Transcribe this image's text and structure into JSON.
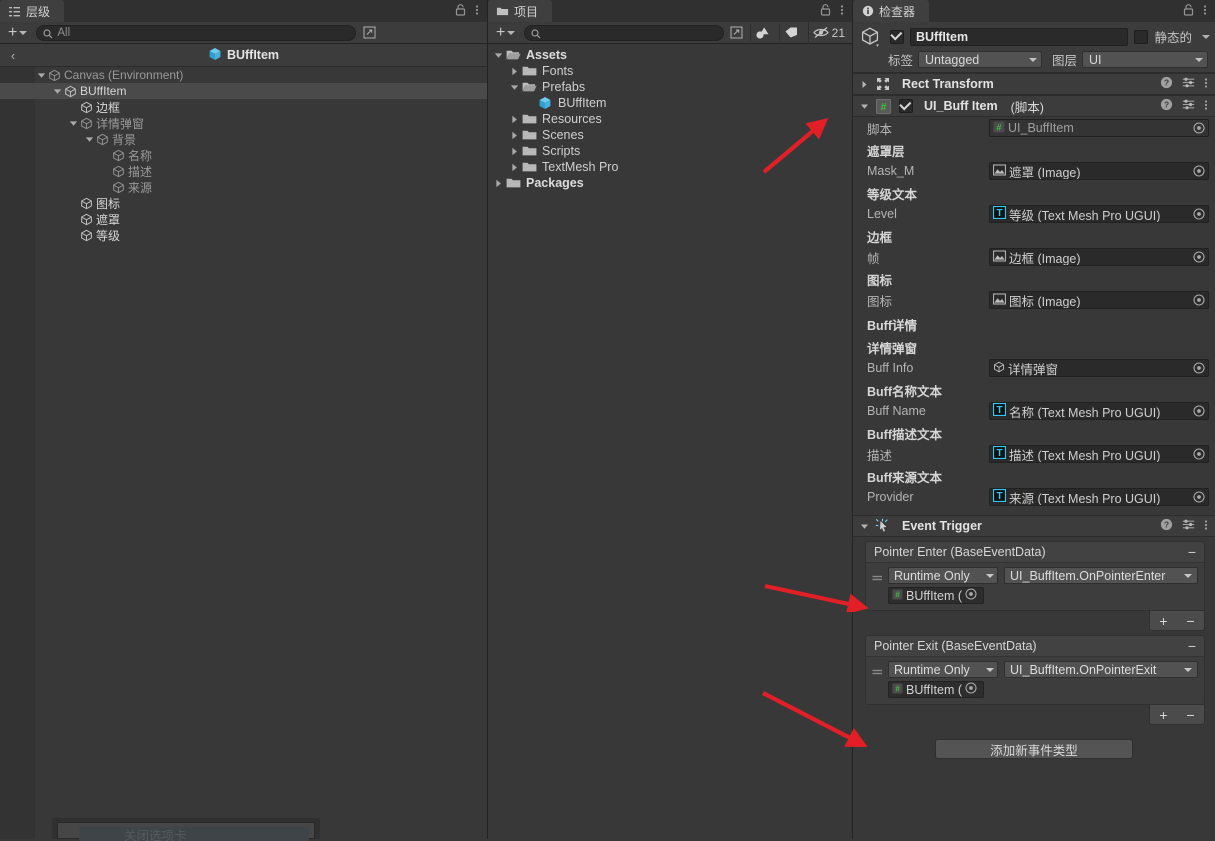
{
  "hierarchy": {
    "tab_label": "层级",
    "tab_icon": "hierarchy-icon",
    "search_placeholder": "All",
    "prefab_title": "BUffItem",
    "tree": [
      {
        "label": "Canvas  (Environment)",
        "depth": 1,
        "expanded": true,
        "selected": false,
        "dim": true
      },
      {
        "label": "BUffItem",
        "depth": 2,
        "expanded": true,
        "selected": true,
        "dim": false
      },
      {
        "label": "边框",
        "depth": 3,
        "expanded": null,
        "selected": false,
        "dim": false
      },
      {
        "label": "详情弹窗",
        "depth": 3,
        "expanded": true,
        "selected": false,
        "dim": true
      },
      {
        "label": "背景",
        "depth": 4,
        "expanded": true,
        "selected": false,
        "dim": true
      },
      {
        "label": "名称",
        "depth": 5,
        "expanded": null,
        "selected": false,
        "dim": true
      },
      {
        "label": "描述",
        "depth": 5,
        "expanded": null,
        "selected": false,
        "dim": true
      },
      {
        "label": "来源",
        "depth": 5,
        "expanded": null,
        "selected": false,
        "dim": true
      },
      {
        "label": "图标",
        "depth": 3,
        "expanded": null,
        "selected": false,
        "dim": false
      },
      {
        "label": "遮罩",
        "depth": 3,
        "expanded": null,
        "selected": false,
        "dim": false
      },
      {
        "label": "等级",
        "depth": 3,
        "expanded": null,
        "selected": false,
        "dim": false
      }
    ]
  },
  "project": {
    "tab_label": "项目",
    "tab_icon": "folder-icon",
    "search_placeholder": "",
    "hidden_count": "21",
    "tree": [
      {
        "label": "Assets",
        "depth": 0,
        "expanded": true,
        "kind": "folder-open",
        "bold": true
      },
      {
        "label": "Fonts",
        "depth": 1,
        "expanded": false,
        "kind": "folder",
        "bold": false
      },
      {
        "label": "Prefabs",
        "depth": 1,
        "expanded": true,
        "kind": "folder-open",
        "bold": false
      },
      {
        "label": "BUffItem",
        "depth": 2,
        "expanded": null,
        "kind": "prefab",
        "bold": false
      },
      {
        "label": "Resources",
        "depth": 1,
        "expanded": false,
        "kind": "folder",
        "bold": false
      },
      {
        "label": "Scenes",
        "depth": 1,
        "expanded": false,
        "kind": "folder",
        "bold": false
      },
      {
        "label": "Scripts",
        "depth": 1,
        "expanded": false,
        "kind": "folder",
        "bold": false
      },
      {
        "label": "TextMesh Pro",
        "depth": 1,
        "expanded": false,
        "kind": "folder",
        "bold": false
      },
      {
        "label": "Packages",
        "depth": 0,
        "expanded": false,
        "kind": "folder",
        "bold": true
      }
    ]
  },
  "inspector": {
    "tab_label": "检查器",
    "tab_icon": "info-icon",
    "gameobject": {
      "enabled": true,
      "name": "BUffItem",
      "static_label": "静态的",
      "static_checked": false,
      "tag_label": "标签",
      "tag_value": "Untagged",
      "layer_label": "图层",
      "layer_value": "UI"
    },
    "components": [
      {
        "title": "Rect Transform",
        "expanded": false,
        "has_toggle": false,
        "suffix": ""
      },
      {
        "title": "UI_Buff Item",
        "expanded": true,
        "has_toggle": true,
        "suffix": "(脚本)"
      }
    ],
    "script_row": {
      "label": "脚本",
      "value": "UI_BuffItem"
    },
    "properties": [
      {
        "group": "遮罩层",
        "label": "Mask_M",
        "value": "遮罩 (Image)",
        "icon": "image-icon"
      },
      {
        "group": "等级文本",
        "label": "Level",
        "value": "等级 (Text Mesh Pro UGUI)",
        "icon": "tmp-icon"
      },
      {
        "group": "边框",
        "label": "帧",
        "value": "边框 (Image)",
        "icon": "image-icon"
      },
      {
        "group": "图标",
        "label": "图标",
        "value": "图标 (Image)",
        "icon": "image-icon"
      }
    ],
    "section_title": "Buff详情",
    "properties2": [
      {
        "group": "详情弹窗",
        "label": "Buff Info",
        "value": "详情弹窗",
        "icon": "gameobject-icon"
      },
      {
        "group": "Buff名称文本",
        "label": "Buff Name",
        "value": "名称 (Text Mesh Pro UGUI)",
        "icon": "tmp-icon"
      },
      {
        "group": "Buff描述文本",
        "label": "描述",
        "value": "描述 (Text Mesh Pro UGUI)",
        "icon": "tmp-icon"
      },
      {
        "group": "Buff来源文本",
        "label": "Provider",
        "value": "来源 (Text Mesh Pro UGUI)",
        "icon": "tmp-icon"
      }
    ],
    "event_trigger": {
      "title": "Event Trigger",
      "entries": [
        {
          "title": "Pointer Enter (BaseEventData)",
          "mode": "Runtime Only",
          "function": "UI_BuffItem.OnPointerEnter",
          "object": "BUffItem ("
        },
        {
          "title": "Pointer Exit (BaseEventData)",
          "mode": "Runtime Only",
          "function": "UI_BuffItem.OnPointerExit",
          "object": "BUffItem ("
        }
      ],
      "add_button": "添加新事件类型"
    }
  },
  "context_menu": {
    "item": "关闭选项卡"
  },
  "colors": {
    "panel_bg": "#383838",
    "header_bg": "#3c3c3c",
    "tab_active": "#3f3f3f",
    "selection": "#4a4a4a",
    "field_bg": "#2a2a2a",
    "dropdown_bg": "#525252",
    "accent_blue": "#4ec2f0",
    "arrow_red": "#e21f26",
    "script_green": "#3f9a3f"
  }
}
